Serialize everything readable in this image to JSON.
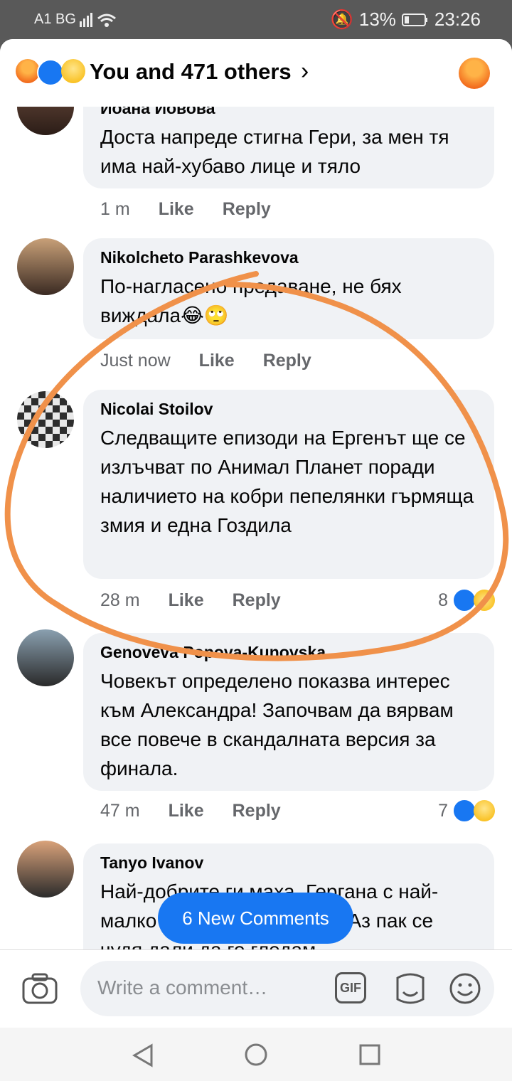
{
  "status": {
    "carrier": "A1 BG",
    "battery": "13%",
    "time": "23:26"
  },
  "header": {
    "title": "You and 471 others",
    "chevron": "›"
  },
  "comments": [
    {
      "name": "Иоана Йовова",
      "text": "Доста напреде стигна Гери, за мен тя има най-хубаво лице и тяло",
      "time": "1 m",
      "like": "Like",
      "reply": "Reply"
    },
    {
      "name": "Nikolcheto Parashkevova",
      "text": "По-нагласено предаване, не бях виждала😂🙄",
      "time": "Just now",
      "like": "Like",
      "reply": "Reply"
    },
    {
      "name": "Nicolai Stoilov",
      "text": "Следващите епизоди на Ергенът ще се излъчват по Анимал Планет поради наличието на кобри пепелянки гърмяща змия и една Гоздила",
      "time": "28 m",
      "like": "Like",
      "reply": "Reply",
      "reactions": "8"
    },
    {
      "name": "Genoveva Popova-Kunovska",
      "text": "Човекът определено показва интерес към Александра! Започвам да вярвам все повече в скандалната версия за финала.",
      "time": "47 m",
      "like": "Like",
      "reply": "Reply",
      "reactions": "7"
    },
    {
      "name": "Tanyo Ivanov",
      "text": "Най-добрите ги маха. Гергана с най-малко шансове си тръгна. Аз пак се чудя дали да го гледам",
      "time": "",
      "like": "",
      "reply": ""
    }
  ],
  "new_comments": "6 New Comments",
  "composer": {
    "placeholder": "Write a comment…",
    "gif": "GIF"
  },
  "colors": {
    "brand": "#1877f2",
    "annotation": "#f0914a"
  }
}
